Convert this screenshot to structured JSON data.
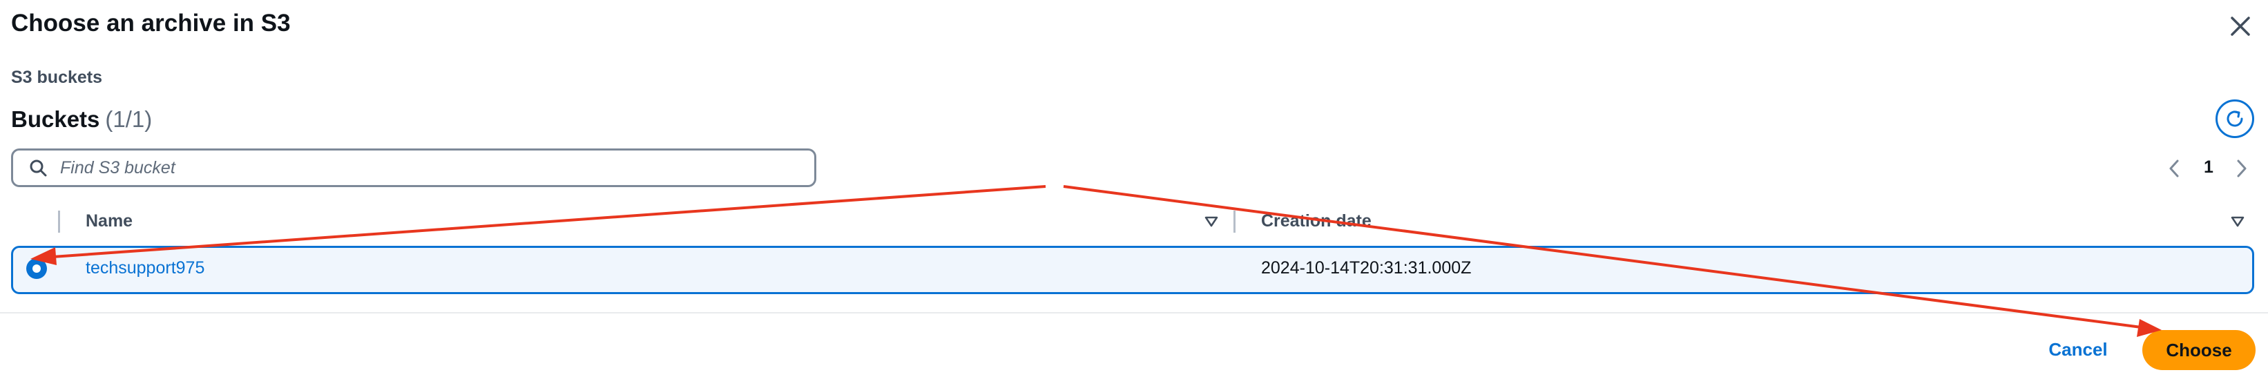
{
  "dialog": {
    "title": "Choose an archive in S3",
    "breadcrumb": "S3 buckets",
    "close_icon": "close-icon"
  },
  "table": {
    "heading": "Buckets",
    "count": "(1/1)",
    "search": {
      "placeholder": "Find S3 bucket",
      "value": ""
    },
    "pagination": {
      "current_page": "1"
    },
    "columns": [
      {
        "label": "Name"
      },
      {
        "label": "Creation date"
      }
    ],
    "rows": [
      {
        "selected": true,
        "name": "techsupport975",
        "creation_date": "2024-10-14T20:31:31.000Z"
      }
    ]
  },
  "footer": {
    "cancel_label": "Cancel",
    "choose_label": "Choose"
  },
  "colors": {
    "primary_blue": "#0972d3",
    "primary_orange": "#ff9900",
    "annotation_red": "#e8361e",
    "row_selected_bg": "#f0f6fd"
  }
}
